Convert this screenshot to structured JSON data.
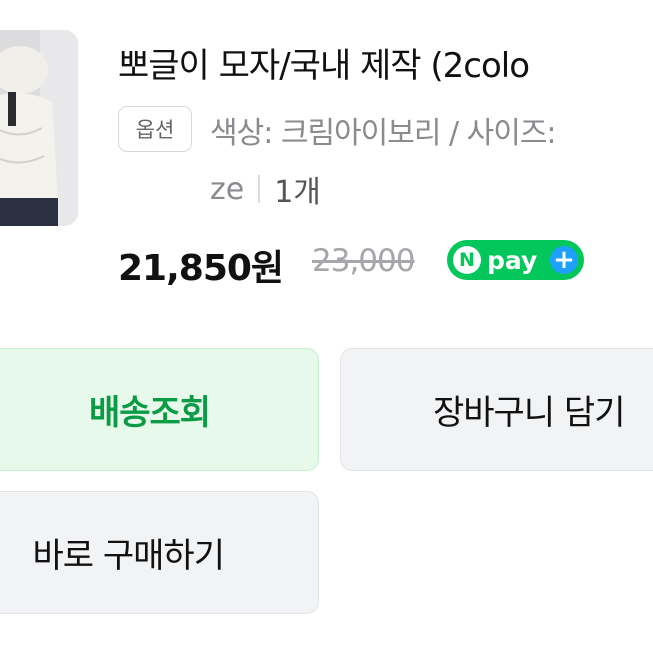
{
  "product": {
    "title": "뽀글이 모자/국내 제작 (2colo",
    "option_badge": "옵션",
    "option_line1": "색상: 크림아이보리 / 사이즈:",
    "option_line2_size": "ze",
    "quantity": "1개",
    "price": "21,850원",
    "original_price": "23,000",
    "npay": {
      "n": "N",
      "label": "pay",
      "plus": "+"
    }
  },
  "buttons": {
    "track": "배송조회",
    "cart": "장바구니 담기",
    "buy": "바로 구매하기"
  },
  "colors": {
    "npay_green": "#03c75a",
    "track_green": "#0b9b45",
    "track_bg": "#e6f9ea",
    "button_gray": "#f2f3f5"
  },
  "icons": {
    "npay_plus": "plus-icon"
  }
}
